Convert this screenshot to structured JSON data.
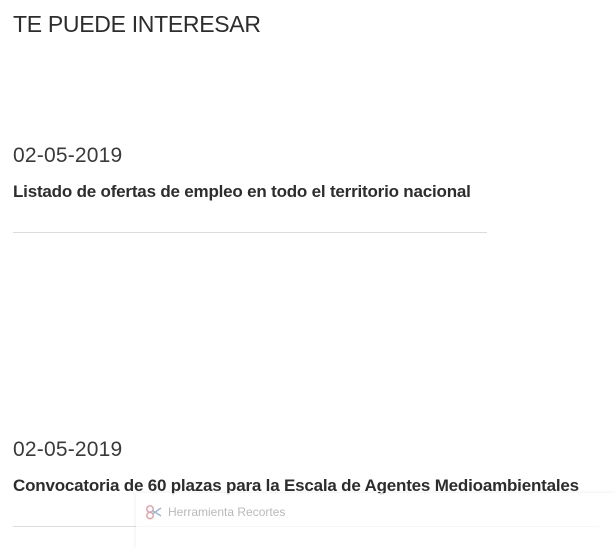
{
  "section": {
    "title": "TE PUEDE INTERESAR"
  },
  "articles": [
    {
      "date": "02-05-2019",
      "title": "Listado de ofertas de empleo en todo el territorio nacional"
    },
    {
      "date": "02-05-2019",
      "title": "Convocatoria de 60 plazas para la Escala de Agentes Medioambientales"
    }
  ],
  "snipping_tool": {
    "label": "Herramienta Recortes",
    "icon": "scissors-icon"
  }
}
